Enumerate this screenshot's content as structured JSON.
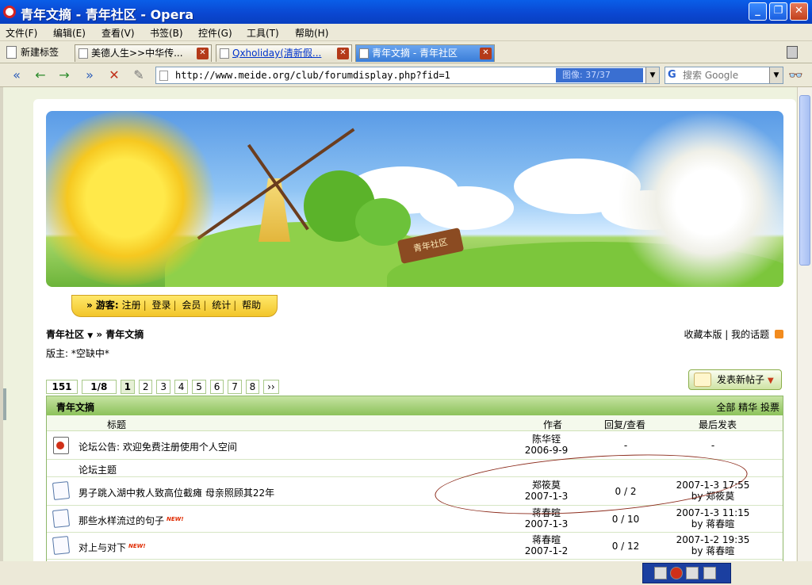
{
  "window": {
    "title": "青年文摘 - 青年社区 - Opera",
    "buttons": {
      "minimize": "_",
      "maximize": "❐",
      "close": "✕"
    }
  },
  "menu": [
    "文件(F)",
    "编辑(E)",
    "查看(V)",
    "书签(B)",
    "控件(G)",
    "工具(T)",
    "帮助(H)"
  ],
  "tabs": {
    "new_tab_label": "新建标签",
    "items": [
      {
        "label": "美德人生>>中华传...",
        "link": false,
        "active": false
      },
      {
        "label": "Qxholiday(清新假...",
        "link": true,
        "active": false
      },
      {
        "label": "青年文摘 - 青年社区",
        "link": false,
        "active": true
      }
    ]
  },
  "address": {
    "url": "http://www.meide.org/club/forumdisplay.php?fid=1",
    "progress": "图像:    37/37",
    "search_placeholder": "搜索 Google"
  },
  "banner": {
    "sign_text": "青年社区"
  },
  "guestbar": {
    "label": "» 游客:",
    "links": [
      "注册",
      "登录",
      "会员",
      "统计",
      "帮助"
    ]
  },
  "crumbs": {
    "home": "青年社区",
    "sep": "»",
    "current": "青年文摘",
    "right_links": [
      "收藏本版",
      "我的话题"
    ]
  },
  "moderator": "版主: *空缺中*",
  "pager": {
    "total": "151",
    "pages": "1/8",
    "numbers": [
      "1",
      "2",
      "3",
      "4",
      "5",
      "6",
      "7",
      "8"
    ],
    "current": "1",
    "next": "››"
  },
  "newpost_label": "发表新帖子",
  "forum": {
    "name": "青年文摘",
    "filters": "全部 精华 投票",
    "columns": {
      "title": "标题",
      "author": "作者",
      "replies": "回复/查看",
      "last": "最后发表"
    },
    "notice": {
      "title": "论坛公告: 欢迎免费注册使用个人空间",
      "author": "陈华铚",
      "date": "2006-9-9",
      "replies": "-",
      "last": "-"
    },
    "subheader": "论坛主题",
    "threads": [
      {
        "title": "男子跳入湖中救人致高位截瘫 母亲照顾其22年",
        "new": false,
        "author": "郑筱莫",
        "date": "2007-1-3",
        "replies": "0 / 2",
        "last_time": "2007-1-3 17:55",
        "last_by": "by 郑筱莫"
      },
      {
        "title": "那些水样流过的句子",
        "new": true,
        "author": "蒋春暄",
        "date": "2007-1-3",
        "replies": "0 / 10",
        "last_time": "2007-1-3 11:15",
        "last_by": "by 蒋春暄"
      },
      {
        "title": "对上与对下",
        "new": true,
        "author": "蒋春暄",
        "date": "2007-1-2",
        "replies": "0 / 12",
        "last_time": "2007-1-2 19:35",
        "last_by": "by 蒋春暄"
      }
    ],
    "new_tag": "NEW!"
  }
}
